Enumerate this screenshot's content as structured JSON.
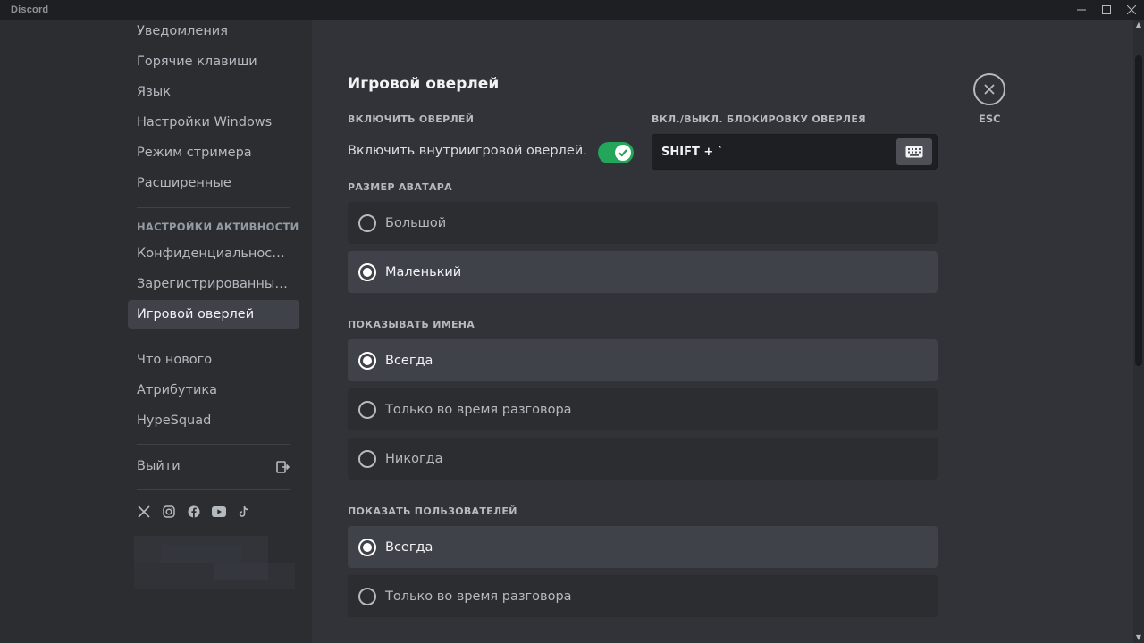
{
  "titlebar": {
    "app_name": "Discord"
  },
  "sidebar": {
    "items_top": [
      "Уведомления",
      "Горячие клавиши",
      "Язык",
      "Настройки Windows",
      "Режим стримера",
      "Расширенные"
    ],
    "activity_header": "НАСТРОЙКИ АКТИВНОСТИ",
    "items_activity": [
      "Конфиденциальность действий",
      "Зарегистрированные игры",
      "Игровой оверлей"
    ],
    "selected_item": "Игровой оверлей",
    "items_info": [
      "Что нового",
      "Атрибутика",
      "HypeSquad"
    ],
    "logout_label": "Выйти",
    "socials": [
      "x-icon",
      "instagram-icon",
      "facebook-icon",
      "youtube-icon",
      "tiktok-icon"
    ]
  },
  "content": {
    "page_title": "Игровой оверлей",
    "enable_overlay": {
      "section_label": "ВКЛЮЧИТЬ ОВЕРЛЕЙ",
      "toggle_label": "Включить внутриигровой оверлей.",
      "enabled": true
    },
    "lock_keybind": {
      "section_label": "ВКЛ./ВЫКЛ. БЛОКИРОВКУ ОВЕРЛЕЯ",
      "value": "SHIFT + `"
    },
    "avatar_size": {
      "section_label": "РАЗМЕР АВАТАРА",
      "options": [
        "Большой",
        "Маленький"
      ],
      "selected": "Маленький"
    },
    "show_names": {
      "section_label": "ПОКАЗЫВАТЬ ИМЕНА",
      "options": [
        "Всегда",
        "Только во время разговора",
        "Никогда"
      ],
      "selected": "Всегда"
    },
    "show_users": {
      "section_label": "ПОКАЗАТЬ ПОЛЬЗОВАТЕЛЕЙ",
      "options": [
        "Всегда",
        "Только во время разговора"
      ],
      "selected": "Всегда"
    },
    "close": {
      "label": "ESC"
    }
  },
  "colors": {
    "accent_green": "#23a55a",
    "sidebar_bg": "#2b2d31",
    "content_bg": "#313338",
    "selected_bg": "#404249"
  }
}
